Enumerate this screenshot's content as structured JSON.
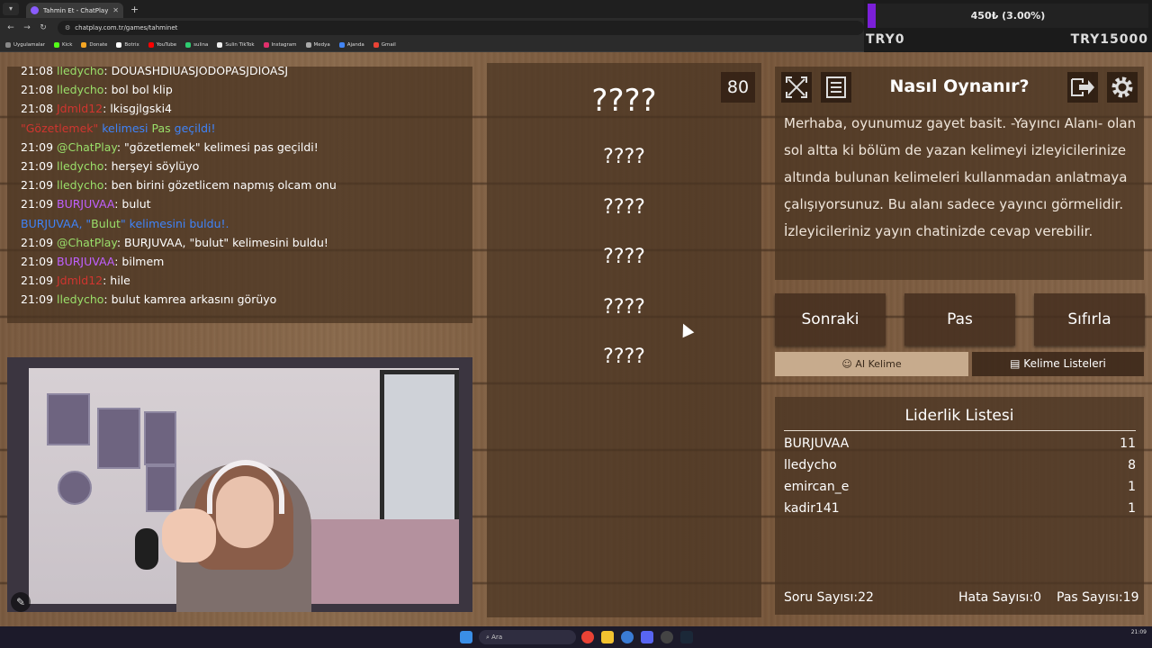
{
  "browser": {
    "tab_title": "Tahmin Et - ChatPlay",
    "url": "chatplay.com.tr/games/tahminet",
    "bookmarks": [
      "Uygulamalar",
      "Kick",
      "Donate",
      "Botrix",
      "YouTube",
      "sulina",
      "Sulin TikTok",
      "Instagram",
      "Medya",
      "Ajanda",
      "Gmail"
    ]
  },
  "overlay": {
    "goal_text": "450₺ (3.00%)",
    "goal_progress": 0.03,
    "left_label": "TRY0",
    "right_label": "TRY15000",
    "accent": "#7b1fd8"
  },
  "chat": [
    {
      "time": "21:08",
      "user": "lledycho",
      "user_color": "#9adf6a",
      "text": ": DOUASHDIUASJODOPASJDIOASJ"
    },
    {
      "time": "21:08",
      "user": "lledycho",
      "user_color": "#9adf6a",
      "text": ": bol bol klip"
    },
    {
      "time": "21:08",
      "user": "Jdmld12",
      "user_color": "#d0352f",
      "text": ": lkisgjlgski4"
    },
    {
      "system": true,
      "parts": [
        {
          "t": "\"Gözetlemek\"",
          "c": "#d0352f"
        },
        {
          "t": " kelimesi ",
          "c": "#3f83f8"
        },
        {
          "t": "Pas",
          "c": "#9adf6a"
        },
        {
          "t": " geçildi!",
          "c": "#3f83f8"
        }
      ]
    },
    {
      "time": "21:09",
      "user": "@ChatPlay",
      "user_color": "#9adf6a",
      "text": ": \"gözetlemek\" kelimesi pas geçildi!"
    },
    {
      "time": "21:09",
      "user": "lledycho",
      "user_color": "#9adf6a",
      "text": ": herşeyi söylüyo"
    },
    {
      "time": "21:09",
      "user": "lledycho",
      "user_color": "#9adf6a",
      "text": ": ben birini gözetlicem napmış olcam onu"
    },
    {
      "time": "21:09",
      "user": "BURJUVAA",
      "user_color": "#c060ff",
      "text": ": bulut"
    },
    {
      "system": true,
      "parts": [
        {
          "t": "BURJUVAA, \"",
          "c": "#3f83f8"
        },
        {
          "t": "Bulut",
          "c": "#9adf6a"
        },
        {
          "t": "\" kelimesini buldu!.",
          "c": "#3f83f8"
        }
      ]
    },
    {
      "time": "21:09",
      "user": "@ChatPlay",
      "user_color": "#9adf6a",
      "text": ": BURJUVAA, \"bulut\" kelimesini buldu!"
    },
    {
      "time": "21:09",
      "user": "BURJUVAA",
      "user_color": "#c060ff",
      "text": ": bilmem"
    },
    {
      "time": "21:09",
      "user": "Jdmld12",
      "user_color": "#d0352f",
      "text": ": hile"
    },
    {
      "time": "21:09",
      "user": "lledycho",
      "user_color": "#9adf6a",
      "text": ": bulut kamrea arkasını görüyo"
    }
  ],
  "game": {
    "counter": "80",
    "main_word": "????",
    "forbidden_words": [
      "????",
      "????",
      "????",
      "????",
      "????"
    ]
  },
  "howto": {
    "title": "Nasıl Oynanır?",
    "text": "Merhaba, oyunumuz gayet basit. -Yayıncı Alanı- olan sol altta ki bölüm de yazan kelimeyi izleyicilerinize altında bulunan kelimeleri kullanmadan anlatmaya çalışıyorsunuz. Bu alanı sadece yayıncı görmelidir. İzleyicileriniz yayın chatinizde cevap verebilir."
  },
  "buttons": {
    "next": "Sonraki",
    "pass": "Pas",
    "reset": "Sıfırla",
    "ai_word": "AI Kelime",
    "word_lists": "Kelime Listeleri"
  },
  "leaderboard": {
    "title": "Liderlik Listesi",
    "rows": [
      {
        "name": "BURJUVAA",
        "score": "11"
      },
      {
        "name": "lledycho",
        "score": "8"
      },
      {
        "name": "emircan_e",
        "score": "1"
      },
      {
        "name": "kadir141",
        "score": "1"
      }
    ],
    "question_count": "Soru Sayısı:22",
    "error_count": "Hata Sayısı:0",
    "pass_count": "Pas Sayısı:19"
  },
  "taskbar": {
    "search": "Ara",
    "time": "21:09"
  }
}
